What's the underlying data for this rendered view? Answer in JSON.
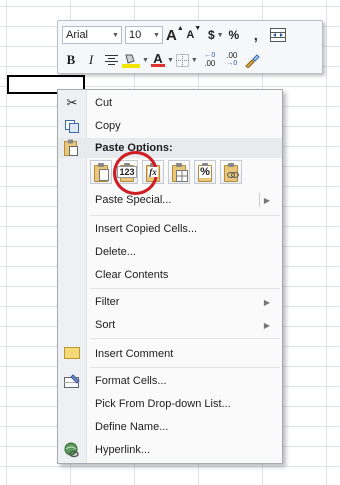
{
  "mini_toolbar": {
    "font_name": "Arial",
    "font_size": "10",
    "grow_font": "A",
    "shrink_font": "A",
    "currency": "$",
    "percent": "%",
    "comma": ",",
    "bold": "B",
    "italic": "I",
    "font_color": "A",
    "increase_decimal": ".00",
    "decrease_decimal": ".00"
  },
  "context_menu": {
    "items": [
      {
        "label": "Cut",
        "icon": "scissors-icon"
      },
      {
        "label": "Copy",
        "icon": "copy-icon"
      },
      {
        "label": "Paste Options:",
        "icon": "paste-icon"
      },
      {
        "label": "Paste Special..."
      },
      {
        "label": "Insert Copied Cells..."
      },
      {
        "label": "Delete..."
      },
      {
        "label": "Clear Contents"
      },
      {
        "label": "Filter"
      },
      {
        "label": "Sort"
      },
      {
        "label": "Insert Comment",
        "icon": "comment-icon"
      },
      {
        "label": "Format Cells...",
        "icon": "format-cells-icon"
      },
      {
        "label": "Pick From Drop-down List..."
      },
      {
        "label": "Define Name..."
      },
      {
        "label": "Hyperlink...",
        "icon": "hyperlink-icon"
      }
    ],
    "paste_options": [
      {
        "name": "paste-icon",
        "glyph": ""
      },
      {
        "name": "paste-values-icon",
        "glyph": "123"
      },
      {
        "name": "paste-formulas-icon",
        "glyph": "fx"
      },
      {
        "name": "paste-transpose-icon",
        "glyph": ""
      },
      {
        "name": "paste-formatting-icon",
        "glyph": "%"
      },
      {
        "name": "paste-link-icon",
        "glyph": ""
      }
    ]
  },
  "colors": {
    "highlight_ring": "#d01c24",
    "fill_color": "#f2e600",
    "font_color": "#e03030"
  }
}
